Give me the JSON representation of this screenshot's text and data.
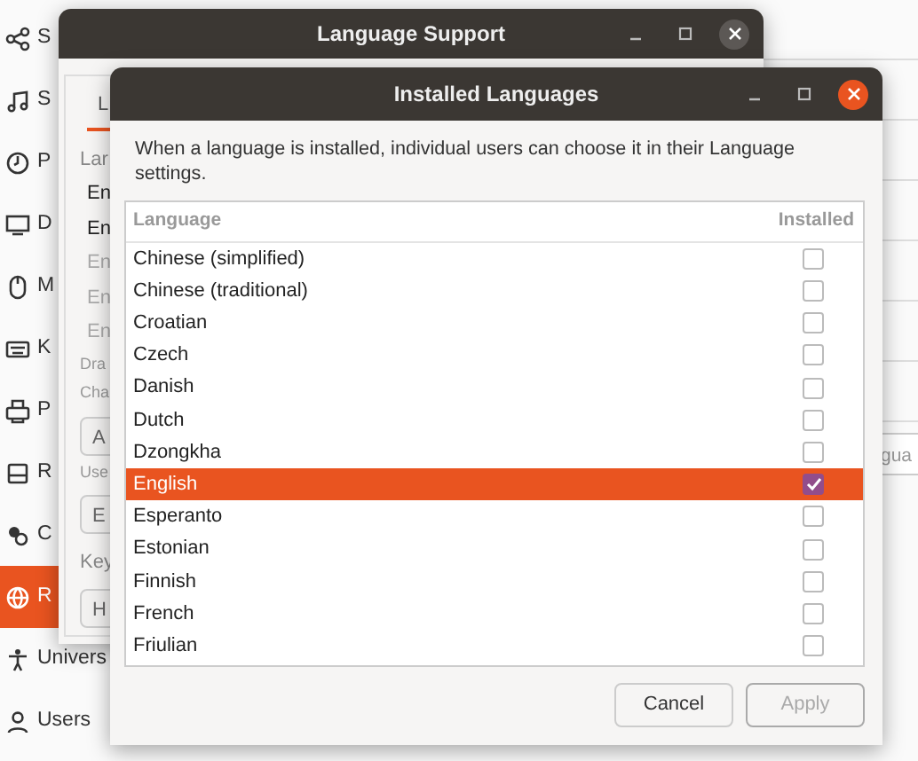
{
  "settings": {
    "sidebar": [
      {
        "label": "S",
        "selected": false
      },
      {
        "label": "S",
        "selected": false
      },
      {
        "label": "P",
        "selected": false
      },
      {
        "label": "D",
        "selected": false
      },
      {
        "label": "M",
        "selected": false
      },
      {
        "label": "K",
        "selected": false
      },
      {
        "label": "P",
        "selected": false
      },
      {
        "label": "R",
        "selected": false
      },
      {
        "label": "C",
        "selected": false
      },
      {
        "label": "R",
        "selected": true
      },
      {
        "label": "Univers",
        "selected": false
      },
      {
        "label": "Users",
        "selected": false
      }
    ],
    "field_text": "gua"
  },
  "language_support": {
    "title": "Language Support",
    "tab": "L",
    "lines": [
      {
        "kind": "heading",
        "text": "Lar"
      },
      {
        "kind": "item",
        "text": "En"
      },
      {
        "kind": "item",
        "text": "En"
      },
      {
        "kind": "dim",
        "text": "En"
      },
      {
        "kind": "dim",
        "text": "En"
      },
      {
        "kind": "dim",
        "text": "En"
      },
      {
        "kind": "caption",
        "text": "Dra"
      },
      {
        "kind": "caption",
        "text": "Cha"
      },
      {
        "kind": "button",
        "text": "A"
      },
      {
        "kind": "caption",
        "text": "Use"
      },
      {
        "kind": "button",
        "text": "E"
      },
      {
        "kind": "heading",
        "text": "Key"
      },
      {
        "kind": "button",
        "text": "H"
      }
    ]
  },
  "dialog": {
    "title": "Installed Languages",
    "description": "When a language is installed, individual users can choose it in their Language settings.",
    "columns": [
      "Language",
      "Installed"
    ],
    "rows": [
      {
        "name": "Chinese (simplified)",
        "installed": false,
        "selected": false
      },
      {
        "name": "Chinese (traditional)",
        "installed": false,
        "selected": false
      },
      {
        "name": "Croatian",
        "installed": false,
        "selected": false
      },
      {
        "name": "Czech",
        "installed": false,
        "selected": false
      },
      {
        "name": "Danish",
        "installed": false,
        "selected": false
      },
      {
        "name": "Dutch",
        "installed": false,
        "selected": false
      },
      {
        "name": "Dzongkha",
        "installed": false,
        "selected": false
      },
      {
        "name": "English",
        "installed": true,
        "selected": true
      },
      {
        "name": "Esperanto",
        "installed": false,
        "selected": false
      },
      {
        "name": "Estonian",
        "installed": false,
        "selected": false
      },
      {
        "name": "Finnish",
        "installed": false,
        "selected": false
      },
      {
        "name": "French",
        "installed": false,
        "selected": false
      },
      {
        "name": "Friulian",
        "installed": false,
        "selected": false
      }
    ],
    "buttons": [
      {
        "label": "Cancel",
        "disabled": false
      },
      {
        "label": "Apply",
        "disabled": true
      }
    ]
  }
}
